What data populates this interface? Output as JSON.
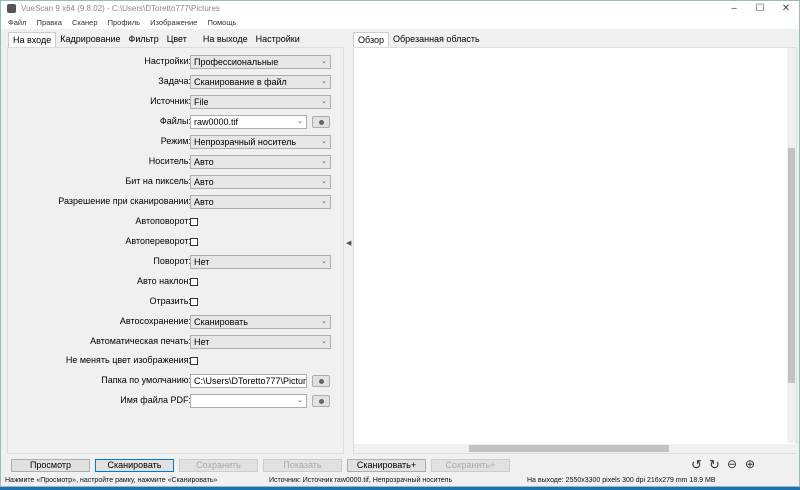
{
  "window": {
    "title": "VueScan 9 x64 (9.8.02) - C:\\Users\\DToretto777\\Pictures"
  },
  "menu": [
    "Файл",
    "Правка",
    "Сканер",
    "Профиль",
    "Изображение",
    "Помощь"
  ],
  "left_tabs": [
    "На входе",
    "Кадрирование",
    "Фильтр",
    "Цвет",
    "На выходе",
    "Настройки"
  ],
  "right_tabs": [
    "Обзор",
    "Обрезанная область"
  ],
  "form": {
    "settings": {
      "label": "Настройки:",
      "value": "Профессиональные"
    },
    "task": {
      "label": "Задача:",
      "value": "Сканирование в файл"
    },
    "source": {
      "label": "Источник:",
      "value": "File"
    },
    "files": {
      "label": "Файлы:",
      "value": "raw0000.tif"
    },
    "mode": {
      "label": "Режим:",
      "value": "Непрозрачный носитель"
    },
    "media": {
      "label": "Носитель:",
      "value": "Авто"
    },
    "bits": {
      "label": "Бит на пиксель:",
      "value": "Авто"
    },
    "resolution": {
      "label": "Разрешение при сканировании:",
      "value": "Авто"
    },
    "autorotate": {
      "label": "Автоповорот:",
      "checked": false
    },
    "autoflip": {
      "label": "Автопереворот:",
      "checked": false
    },
    "rotation": {
      "label": "Поворот:",
      "value": "Нет"
    },
    "autoskew": {
      "label": "Авто наклон:",
      "checked": false
    },
    "mirror": {
      "label": "Отразить:",
      "checked": false
    },
    "autosave": {
      "label": "Автосохранение:",
      "value": "Сканировать"
    },
    "autoprint": {
      "label": "Автоматическая печать:",
      "value": "Нет"
    },
    "keepcolor": {
      "label": "Не менять цвет изображения:",
      "checked": false
    },
    "folder": {
      "label": "Папка по умолчанию:",
      "value": "C:\\Users\\DToretto777\\Pictur"
    },
    "pdfname": {
      "label": "Имя файла PDF:",
      "value": ""
    }
  },
  "buttons": {
    "preview": "Просмотр",
    "scan": "Сканировать",
    "save": "Сохранить",
    "show": "Показать",
    "scanplus": "Сканировать+",
    "saveplus": "Сохранить+"
  },
  "status": {
    "hint": "Нажмите «Просмотр», настройте рамку, нажмите «Сканировать»",
    "source": "Источник: Источник raw0000.tif, Непрозрачный носитель",
    "output": "На выходе: 2550x3300 pixels 300 dpi 216x279 mm 18.9 MB"
  }
}
